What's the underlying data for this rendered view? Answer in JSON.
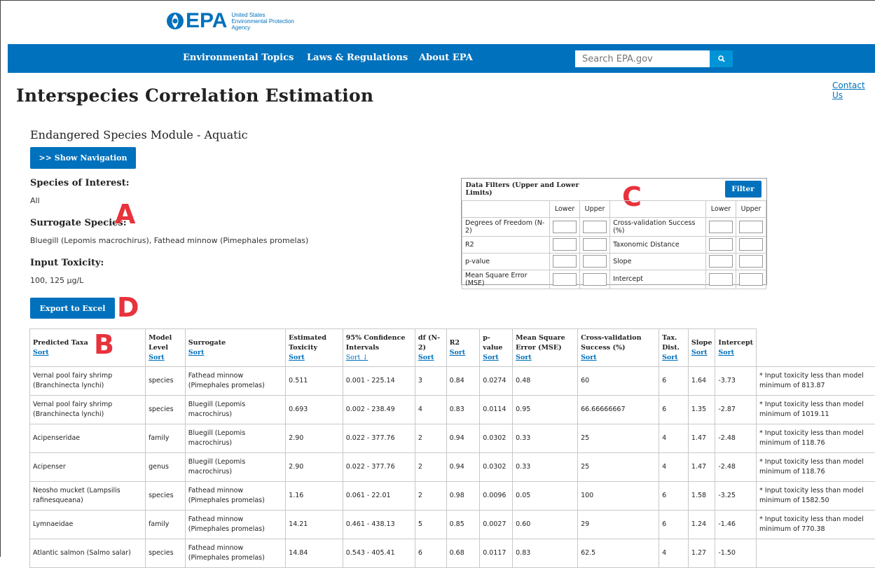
{
  "logo": {
    "wordmark": "EPA",
    "line1": "United States",
    "line2": "Environmental Protection",
    "line3": "Agency"
  },
  "nav": {
    "items": [
      "Environmental Topics",
      "Laws & Regulations",
      "About EPA"
    ],
    "search_placeholder": "Search EPA.gov"
  },
  "contact": "Contact Us",
  "page_title": "Interspecies Correlation Estimation",
  "module_title": "Endangered Species Module - Aquatic",
  "show_nav_button": ">> Show Navigation",
  "species_of_interest": {
    "label": "Species of Interest:",
    "value": "All"
  },
  "surrogate_species": {
    "label": "Surrogate Species:",
    "value": "Bluegill (Lepomis macrochirus), Fathead minnow (Pimephales promelas)"
  },
  "input_toxicity": {
    "label": "Input Toxicity:",
    "value": "100, 125 µg/L"
  },
  "export_button": "Export to Excel",
  "markers": {
    "a": "A",
    "b": "B",
    "c": "C",
    "d": "D"
  },
  "filters": {
    "title": "Data Filters (Upper and Lower Limits)",
    "button": "Filter",
    "lower": "Lower",
    "upper": "Upper",
    "left": [
      "Degrees of Freedom (N-2)",
      "R2",
      "p-value",
      "Mean Square Error (MSE)"
    ],
    "right": [
      "Cross-validation Success (%)",
      "Taxonomic Distance",
      "Slope",
      "Intercept"
    ]
  },
  "table": {
    "sort_label": "Sort",
    "sort_label_active": "Sort ↓",
    "headers": [
      "Predicted Taxa",
      "Model Level",
      "Surrogate",
      "Estimated Toxicity",
      "95% Confidence Intervals",
      "df (N-2)",
      "R2",
      "p-value",
      "Mean Square Error (MSE)",
      "Cross-validation Success (%)",
      "Tax. Dist.",
      "Slope",
      "Intercept"
    ],
    "rows": [
      [
        "Vernal pool fairy shrimp (Branchinecta lynchi)",
        "species",
        "Fathead minnow (Pimephales promelas)",
        "0.511",
        "0.001 - 225.14",
        "3",
        "0.84",
        "0.0274",
        "0.48",
        "60",
        "6",
        "1.64",
        "-3.73",
        "* Input toxicity less than model minimum of 813.87"
      ],
      [
        "Vernal pool fairy shrimp (Branchinecta lynchi)",
        "species",
        "Bluegill (Lepomis macrochirus)",
        "0.693",
        "0.002 - 238.49",
        "4",
        "0.83",
        "0.0114",
        "0.95",
        "66.66666667",
        "6",
        "1.35",
        "-2.87",
        "* Input toxicity less than model minimum of 1019.11"
      ],
      [
        "Acipenseridae",
        "family",
        "Bluegill (Lepomis macrochirus)",
        "2.90",
        "0.022 - 377.76",
        "2",
        "0.94",
        "0.0302",
        "0.33",
        "25",
        "4",
        "1.47",
        "-2.48",
        "* Input toxicity less than model minimum of 118.76"
      ],
      [
        "Acipenser",
        "genus",
        "Bluegill (Lepomis macrochirus)",
        "2.90",
        "0.022 - 377.76",
        "2",
        "0.94",
        "0.0302",
        "0.33",
        "25",
        "4",
        "1.47",
        "-2.48",
        "* Input toxicity less than model minimum of 118.76"
      ],
      [
        "Neosho mucket (Lampsilis rafinesqueana)",
        "species",
        "Fathead minnow (Pimephales promelas)",
        "1.16",
        "0.061 - 22.01",
        "2",
        "0.98",
        "0.0096",
        "0.05",
        "100",
        "6",
        "1.58",
        "-3.25",
        "* Input toxicity less than model minimum of 1582.50"
      ],
      [
        "Lymnaeidae",
        "family",
        "Fathead minnow (Pimephales promelas)",
        "14.21",
        "0.461 - 438.13",
        "5",
        "0.85",
        "0.0027",
        "0.60",
        "29",
        "6",
        "1.24",
        "-1.46",
        "* Input toxicity less than model minimum of 770.38"
      ],
      [
        "Atlantic salmon (Salmo salar)",
        "species",
        "Fathead minnow (Pimephales promelas)",
        "14.84",
        "0.543 - 405.41",
        "6",
        "0.68",
        "0.0117",
        "0.83",
        "62.5",
        "4",
        "1.27",
        "-1.50",
        ""
      ]
    ]
  },
  "colors": {
    "brand": "#0071bc",
    "search_button": "#0094d6",
    "marker": "#e8323c"
  }
}
